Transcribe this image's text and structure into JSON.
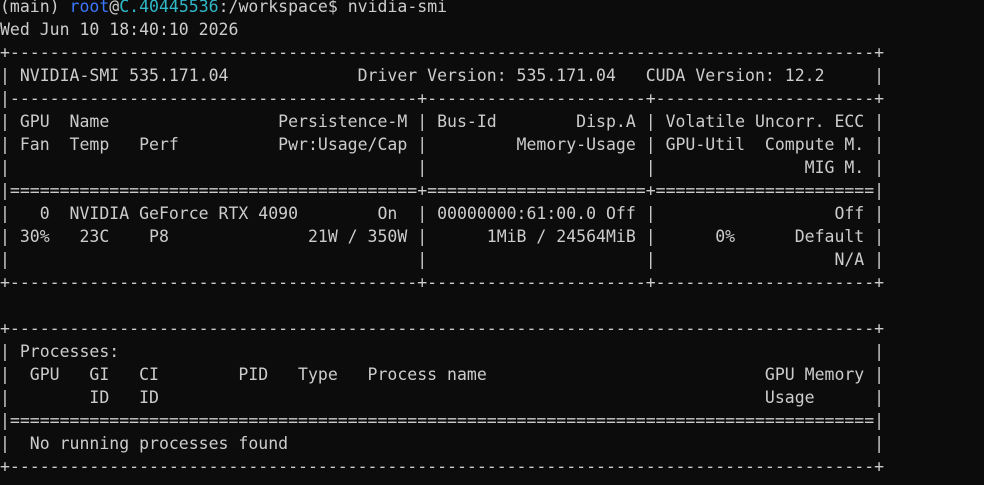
{
  "prompt": {
    "env": "(main) ",
    "user": "root",
    "at": "@",
    "host": "C.40445536",
    "path": ":/workspace$ ",
    "command": "nvidia-smi"
  },
  "output_lines": [
    "Wed Jun 10 18:40:10 2026",
    "+---------------------------------------------------------------------------------------+",
    "| NVIDIA-SMI 535.171.04             Driver Version: 535.171.04   CUDA Version: 12.2     |",
    "|-----------------------------------------+----------------------+----------------------+",
    "| GPU  Name                 Persistence-M | Bus-Id        Disp.A | Volatile Uncorr. ECC |",
    "| Fan  Temp   Perf          Pwr:Usage/Cap |         Memory-Usage | GPU-Util  Compute M. |",
    "|                                         |                      |               MIG M. |",
    "|=========================================+======================+======================|",
    "|   0  NVIDIA GeForce RTX 4090        On  | 00000000:61:00.0 Off |                  Off |",
    "| 30%   23C    P8              21W / 350W |      1MiB / 24564MiB |      0%      Default |",
    "|                                         |                      |                  N/A |",
    "+-----------------------------------------+----------------------+----------------------+",
    "",
    "+---------------------------------------------------------------------------------------+",
    "| Processes:                                                                            |",
    "|  GPU   GI   CI        PID   Type   Process name                            GPU Memory |",
    "|        ID   ID                                                             Usage      |",
    "|=======================================================================================|",
    "|  No running processes found                                                           |",
    "+---------------------------------------------------------------------------------------+"
  ]
}
